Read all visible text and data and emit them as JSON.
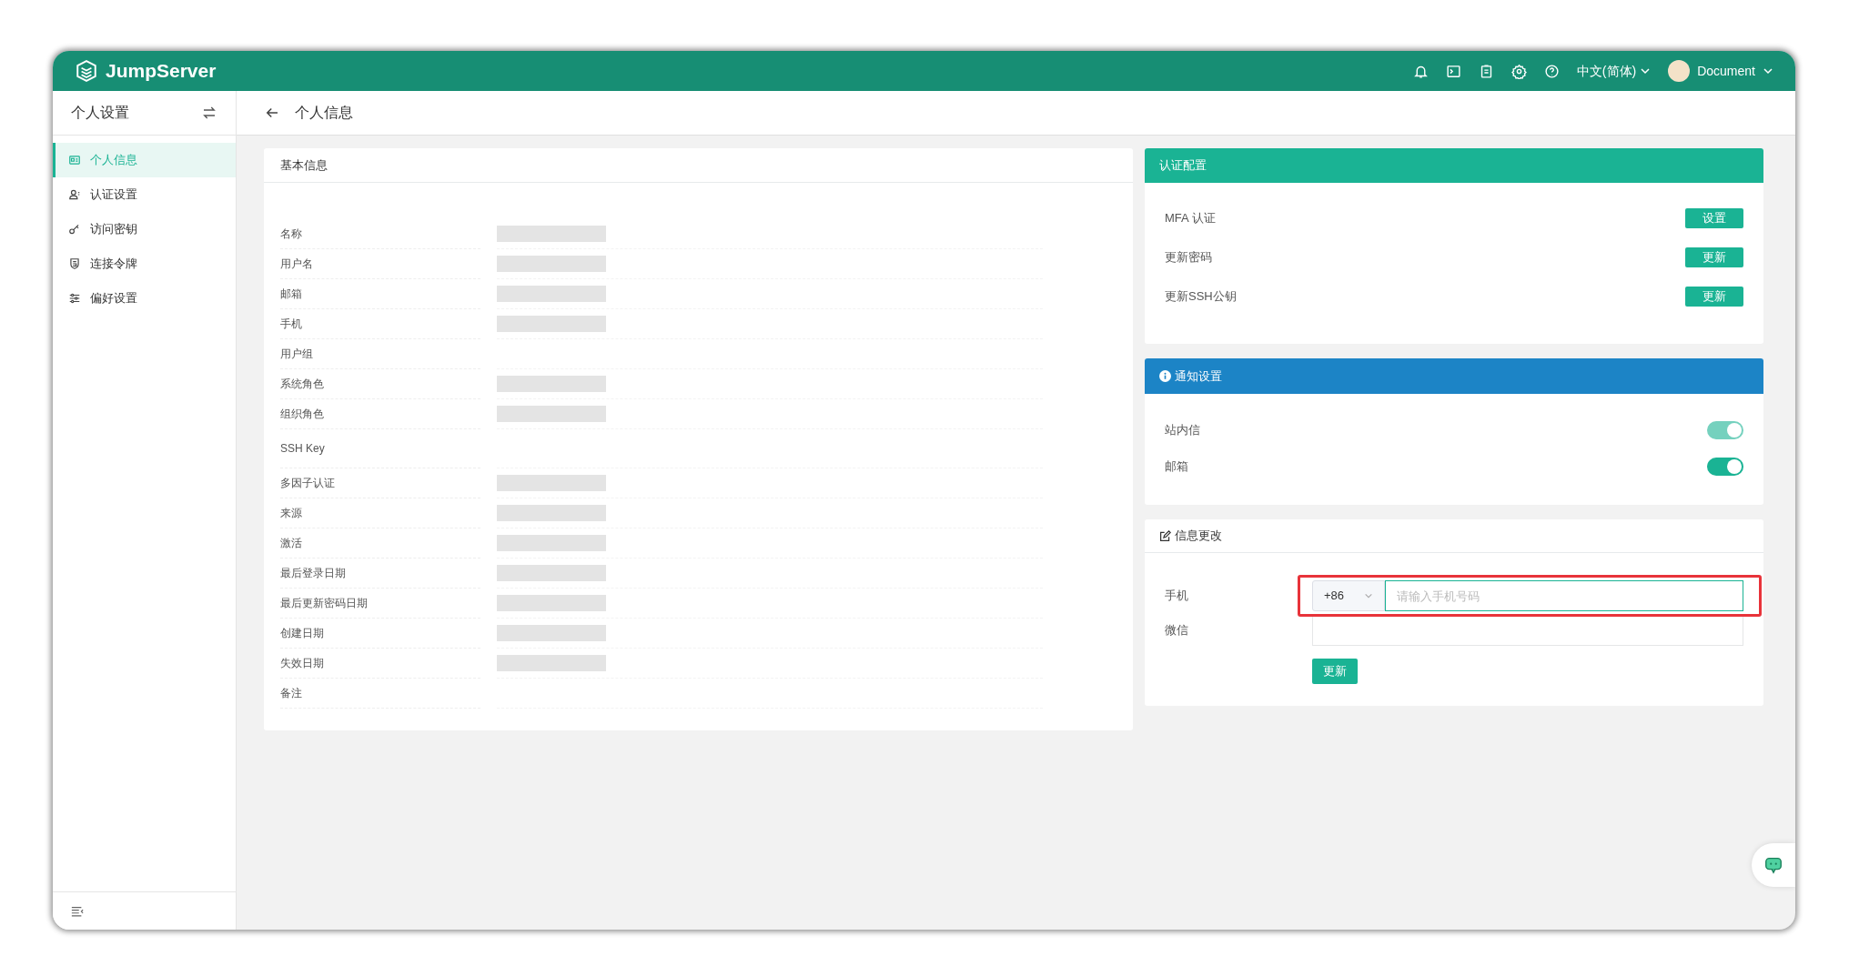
{
  "header": {
    "logo": "JumpServer",
    "language": "中文(简体)",
    "user": "Document"
  },
  "sidebar": {
    "title": "个人设置",
    "items": [
      {
        "label": "个人信息",
        "kind": "card",
        "selected": true
      },
      {
        "label": "认证设置",
        "kind": "user",
        "selected": false
      },
      {
        "label": "访问密钥",
        "kind": "key",
        "selected": false
      },
      {
        "label": "连接令牌",
        "kind": "shield",
        "selected": false
      },
      {
        "label": "偏好设置",
        "kind": "sliders",
        "selected": false
      }
    ]
  },
  "page_title": "个人信息",
  "basic_info": {
    "title": "基本信息",
    "rows": [
      {
        "label": "名称",
        "redacted": true
      },
      {
        "label": "用户名",
        "redacted": true
      },
      {
        "label": "邮箱",
        "redacted": true
      },
      {
        "label": "手机",
        "redacted": true
      },
      {
        "label": "用户组",
        "redacted": false
      },
      {
        "label": "系统角色",
        "redacted": true
      },
      {
        "label": "组织角色",
        "redacted": true
      },
      {
        "label": "SSH Key",
        "redacted": false
      },
      {
        "label": "多因子认证",
        "redacted": true
      },
      {
        "label": "来源",
        "redacted": true
      },
      {
        "label": "激活",
        "redacted": true
      },
      {
        "label": "最后登录日期",
        "redacted": true
      },
      {
        "label": "最后更新密码日期",
        "redacted": true
      },
      {
        "label": "创建日期",
        "redacted": true
      },
      {
        "label": "失效日期",
        "redacted": true
      },
      {
        "label": "备注",
        "redacted": false
      }
    ]
  },
  "auth_config": {
    "title": "认证配置",
    "rows": [
      {
        "label": "MFA 认证",
        "button": "设置"
      },
      {
        "label": "更新密码",
        "button": "更新"
      },
      {
        "label": "更新SSH公钥",
        "button": "更新"
      }
    ]
  },
  "notification": {
    "title": "通知设置",
    "rows": [
      {
        "label": "站内信",
        "on": true,
        "disabled": true
      },
      {
        "label": "邮箱",
        "on": true,
        "disabled": false
      }
    ]
  },
  "info_change": {
    "title": "信息更改",
    "phone": {
      "label": "手机",
      "country_code": "+86",
      "placeholder": "请输入手机号码",
      "highlighted": true
    },
    "wechat": {
      "label": "微信"
    },
    "submit": "更新"
  }
}
